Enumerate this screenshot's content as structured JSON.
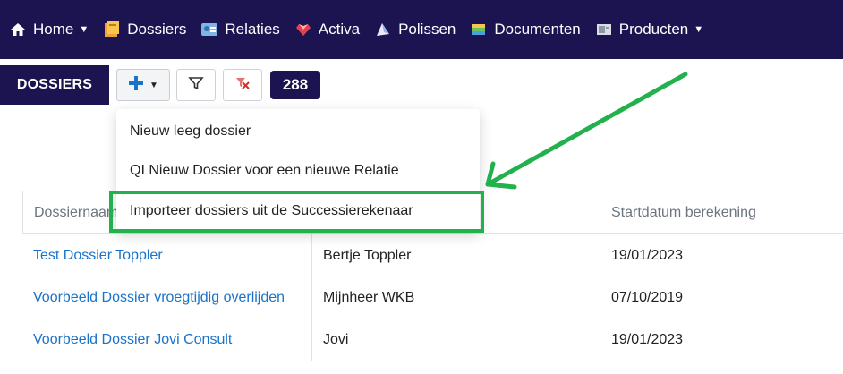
{
  "nav": {
    "items": [
      {
        "label": "Home",
        "icon": "home-icon",
        "has_caret": true
      },
      {
        "label": "Dossiers",
        "icon": "dossiers-icon"
      },
      {
        "label": "Relaties",
        "icon": "relaties-icon"
      },
      {
        "label": "Activa",
        "icon": "activa-icon"
      },
      {
        "label": "Polissen",
        "icon": "polissen-icon"
      },
      {
        "label": "Documenten",
        "icon": "documenten-icon"
      },
      {
        "label": "Producten",
        "icon": "producten-icon",
        "has_caret": true
      }
    ]
  },
  "toolbar": {
    "title": "DOSSIERS",
    "count": "288"
  },
  "dropdown": {
    "items": [
      "Nieuw leeg dossier",
      "QI Nieuw Dossier voor een nieuwe Relatie",
      "Importeer dossiers uit de Successierekenaar"
    ]
  },
  "table": {
    "columns": [
      "Dossiernaam",
      "",
      "Startdatum berekening"
    ],
    "rows": [
      {
        "name": "Test Dossier Toppler",
        "relatie": "Bertje Toppler",
        "date": "19/01/2023"
      },
      {
        "name": "Voorbeeld Dossier vroegtijdig overlijden",
        "relatie": "Mijnheer WKB",
        "date": "07/10/2019"
      },
      {
        "name": "Voorbeeld Dossier Jovi Consult",
        "relatie": "Jovi",
        "date": "19/01/2023"
      }
    ]
  },
  "colors": {
    "nav_bg": "#1b1450",
    "link": "#1a73c9",
    "highlight": "#22b14c",
    "plus": "#1a73c9"
  }
}
